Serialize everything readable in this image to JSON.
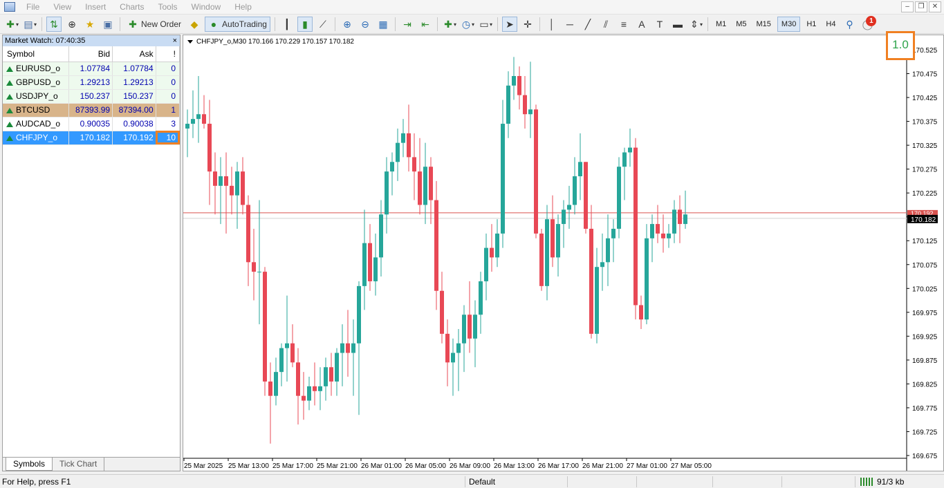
{
  "menu": [
    "File",
    "View",
    "Insert",
    "Charts",
    "Tools",
    "Window",
    "Help"
  ],
  "toolbar": {
    "new_order": "New Order",
    "autotrading": "AutoTrading",
    "timeframes": [
      "M1",
      "M5",
      "M15",
      "M30",
      "H1",
      "H4"
    ],
    "active_timeframe": "M30",
    "notification_count": "1"
  },
  "market_watch": {
    "title": "Market Watch: 07:40:35",
    "close": "×",
    "columns": [
      "Symbol",
      "Bid",
      "Ask",
      "!"
    ],
    "rows": [
      {
        "symbol": "EURUSD_o",
        "bid": "1.07784",
        "ask": "1.07784",
        "spread": "0",
        "style": "light"
      },
      {
        "symbol": "GBPUSD_o",
        "bid": "1.29213",
        "ask": "1.29213",
        "spread": "0",
        "style": "light"
      },
      {
        "symbol": "USDJPY_o",
        "bid": "150.237",
        "ask": "150.237",
        "spread": "0",
        "style": "light"
      },
      {
        "symbol": "BTCUSD",
        "bid": "87393.99",
        "ask": "87394.00",
        "spread": "1",
        "style": "btc"
      },
      {
        "symbol": "AUDCAD_o",
        "bid": "0.90035",
        "ask": "0.90038",
        "spread": "3",
        "style": "white"
      },
      {
        "symbol": "CHFJPY_o",
        "bid": "170.182",
        "ask": "170.192",
        "spread": "10",
        "style": "sel"
      }
    ],
    "tabs": [
      "Symbols",
      "Tick Chart"
    ]
  },
  "chart": {
    "header": "CHFJPY_o,M30  170.166 170.229 170.157 170.182",
    "spread_indicator": "1.0",
    "bid_label": "170.182",
    "ask_label": "170.192",
    "colors": {
      "up": "#26a69a",
      "down": "#e84855",
      "bid_line": "#d9534f"
    }
  },
  "chart_data": {
    "type": "candlestick",
    "symbol": "CHFJPY_o",
    "timeframe": "M30",
    "ylim": [
      169.65,
      170.55
    ],
    "y_ticks": [
      "170.525",
      "170.475",
      "170.425",
      "170.375",
      "170.325",
      "170.275",
      "170.225",
      "170.175",
      "170.125",
      "170.075",
      "170.025",
      "169.975",
      "169.925",
      "169.875",
      "169.825",
      "169.775",
      "169.725",
      "169.675"
    ],
    "x_ticks": [
      "25 Mar 2025",
      "25 Mar 13:00",
      "25 Mar 17:00",
      "25 Mar 21:00",
      "26 Mar 01:00",
      "26 Mar 05:00",
      "26 Mar 09:00",
      "26 Mar 13:00",
      "26 Mar 17:00",
      "26 Mar 21:00",
      "27 Mar 01:00",
      "27 Mar 05:00"
    ],
    "current_bid": 170.182,
    "current_ask": 170.192,
    "ohlc": [
      [
        170.36,
        170.4,
        170.3,
        170.37
      ],
      [
        170.37,
        170.44,
        170.34,
        170.38
      ],
      [
        170.38,
        170.47,
        170.33,
        170.39
      ],
      [
        170.39,
        170.43,
        170.36,
        170.37
      ],
      [
        170.37,
        170.42,
        170.2,
        170.27
      ],
      [
        170.27,
        170.31,
        170.18,
        170.24
      ],
      [
        170.24,
        170.3,
        170.16,
        170.26
      ],
      [
        170.26,
        170.31,
        170.14,
        170.24
      ],
      [
        170.24,
        170.28,
        170.18,
        170.22
      ],
      [
        170.22,
        170.29,
        170.15,
        170.27
      ],
      [
        170.27,
        170.3,
        170.18,
        170.2
      ],
      [
        170.2,
        170.22,
        170.03,
        170.08
      ],
      [
        170.08,
        170.15,
        170.0,
        170.06
      ],
      [
        170.06,
        170.21,
        169.95,
        170.06
      ],
      [
        170.06,
        170.07,
        169.8,
        169.83
      ],
      [
        169.83,
        169.87,
        169.7,
        169.8
      ],
      [
        169.8,
        169.88,
        169.78,
        169.85
      ],
      [
        169.85,
        169.91,
        169.82,
        169.9
      ],
      [
        169.9,
        170.01,
        169.83,
        169.91
      ],
      [
        169.91,
        169.95,
        169.86,
        169.87
      ],
      [
        169.87,
        169.9,
        169.74,
        169.8
      ],
      [
        169.8,
        169.85,
        169.75,
        169.79
      ],
      [
        169.79,
        169.84,
        169.77,
        169.82
      ],
      [
        169.82,
        169.87,
        169.78,
        169.81
      ],
      [
        169.81,
        169.86,
        169.77,
        169.82
      ],
      [
        169.82,
        169.88,
        169.79,
        169.86
      ],
      [
        169.86,
        169.89,
        169.8,
        169.83
      ],
      [
        169.83,
        169.9,
        169.8,
        169.89
      ],
      [
        169.89,
        169.95,
        169.82,
        169.91
      ],
      [
        169.91,
        169.98,
        169.84,
        169.89
      ],
      [
        169.89,
        169.96,
        169.8,
        169.91
      ],
      [
        169.91,
        170.04,
        169.76,
        170.03
      ],
      [
        170.03,
        170.19,
        169.98,
        170.12
      ],
      [
        170.12,
        170.16,
        170.02,
        170.04
      ],
      [
        170.04,
        170.14,
        170.01,
        170.09
      ],
      [
        170.09,
        170.21,
        170.05,
        170.18
      ],
      [
        170.18,
        170.3,
        170.14,
        170.27
      ],
      [
        170.27,
        170.31,
        170.22,
        170.29
      ],
      [
        170.29,
        170.36,
        170.25,
        170.33
      ],
      [
        170.33,
        170.38,
        170.3,
        170.35
      ],
      [
        170.35,
        170.41,
        170.27,
        170.3
      ],
      [
        170.3,
        170.35,
        170.21,
        170.27
      ],
      [
        170.27,
        170.34,
        170.18,
        170.2
      ],
      [
        170.2,
        170.33,
        170.16,
        170.28
      ],
      [
        170.28,
        170.3,
        170.16,
        170.21
      ],
      [
        170.21,
        170.25,
        169.98,
        170.02
      ],
      [
        170.02,
        170.06,
        169.91,
        169.93
      ],
      [
        169.93,
        169.96,
        169.82,
        169.87
      ],
      [
        169.87,
        169.92,
        169.8,
        169.89
      ],
      [
        169.89,
        169.94,
        169.81,
        169.91
      ],
      [
        169.91,
        169.99,
        169.85,
        169.97
      ],
      [
        169.97,
        170.04,
        169.89,
        169.92
      ],
      [
        169.92,
        170.0,
        169.86,
        169.97
      ],
      [
        169.97,
        170.06,
        169.93,
        170.04
      ],
      [
        170.04,
        170.14,
        170.0,
        170.11
      ],
      [
        170.11,
        170.16,
        170.06,
        170.09
      ],
      [
        170.09,
        170.17,
        170.07,
        170.14
      ],
      [
        170.14,
        170.42,
        170.11,
        170.37
      ],
      [
        170.37,
        170.48,
        170.34,
        170.45
      ],
      [
        170.45,
        170.51,
        170.42,
        170.47
      ],
      [
        170.47,
        170.49,
        170.4,
        170.43
      ],
      [
        170.43,
        170.47,
        170.36,
        170.39
      ],
      [
        170.39,
        170.5,
        170.34,
        170.4
      ],
      [
        170.4,
        170.41,
        170.13,
        170.14
      ],
      [
        170.14,
        170.15,
        170.02,
        170.03
      ],
      [
        170.03,
        170.2,
        170.0,
        170.17
      ],
      [
        170.17,
        170.22,
        170.07,
        170.09
      ],
      [
        170.09,
        170.18,
        170.05,
        170.16
      ],
      [
        170.16,
        170.21,
        170.11,
        170.19
      ],
      [
        170.19,
        170.24,
        170.15,
        170.2
      ],
      [
        170.2,
        170.3,
        170.18,
        170.26
      ],
      [
        170.26,
        170.35,
        170.21,
        170.29
      ],
      [
        170.29,
        170.29,
        170.14,
        170.15
      ],
      [
        170.15,
        170.2,
        169.92,
        169.93
      ],
      [
        169.93,
        170.11,
        169.91,
        170.07
      ],
      [
        170.07,
        170.14,
        170.02,
        170.08
      ],
      [
        170.08,
        170.18,
        170.03,
        170.13
      ],
      [
        170.13,
        170.17,
        170.08,
        170.15
      ],
      [
        170.15,
        170.3,
        170.13,
        170.28
      ],
      [
        170.28,
        170.32,
        170.21,
        170.31
      ],
      [
        170.31,
        170.36,
        170.28,
        170.32
      ],
      [
        170.32,
        170.34,
        169.96,
        169.99
      ],
      [
        169.99,
        170.01,
        169.94,
        169.96
      ],
      [
        169.96,
        170.16,
        169.95,
        170.13
      ],
      [
        170.13,
        170.18,
        170.08,
        170.16
      ],
      [
        170.16,
        170.2,
        170.12,
        170.14
      ],
      [
        170.14,
        170.18,
        170.1,
        170.13
      ],
      [
        170.13,
        170.16,
        170.11,
        170.14
      ],
      [
        170.14,
        170.21,
        170.12,
        170.19
      ],
      [
        170.19,
        170.22,
        170.12,
        170.16
      ],
      [
        170.16,
        170.23,
        170.15,
        170.18
      ]
    ]
  },
  "statusbar": {
    "help": "For Help, press F1",
    "profile": "Default",
    "traffic": "91/3 kb"
  }
}
